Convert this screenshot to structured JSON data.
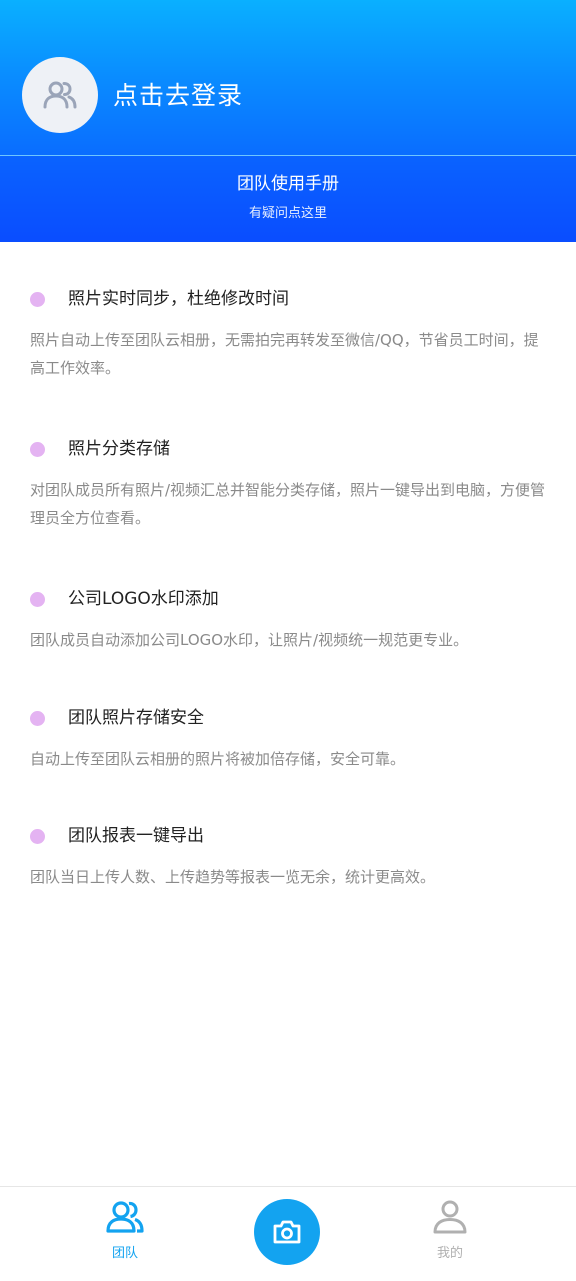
{
  "header": {
    "login_text": "点击去登录"
  },
  "manual": {
    "title": "团队使用手册",
    "subtitle": "有疑问点这里"
  },
  "features": [
    {
      "title": "照片实时同步，杜绝修改时间",
      "desc": "照片自动上传至团队云相册，无需拍完再转发至微信/QQ，节省员工时间，提高工作效率。"
    },
    {
      "title": "照片分类存储",
      "desc": "对团队成员所有照片/视频汇总并智能分类存储，照片一键导出到电脑，方便管理员全方位查看。"
    },
    {
      "title": "公司LOGO水印添加",
      "desc": "团队成员自动添加公司LOGO水印，让照片/视频统一规范更专业。"
    },
    {
      "title": "团队照片存储安全",
      "desc": "自动上传至团队云相册的照片将被加倍存储，安全可靠。"
    },
    {
      "title": "团队报表一键导出",
      "desc": "团队当日上传人数、上传趋势等报表一览无余，统计更高效。"
    }
  ],
  "tabbar": {
    "team_label": "团队",
    "mine_label": "我的",
    "team_icon": "team-icon",
    "camera_icon": "camera-icon",
    "mine_icon": "user-icon"
  },
  "colors": {
    "accent": "#13a3f0",
    "bullet": "#e4b3f2",
    "inactive_tab": "#b0b0b0"
  }
}
